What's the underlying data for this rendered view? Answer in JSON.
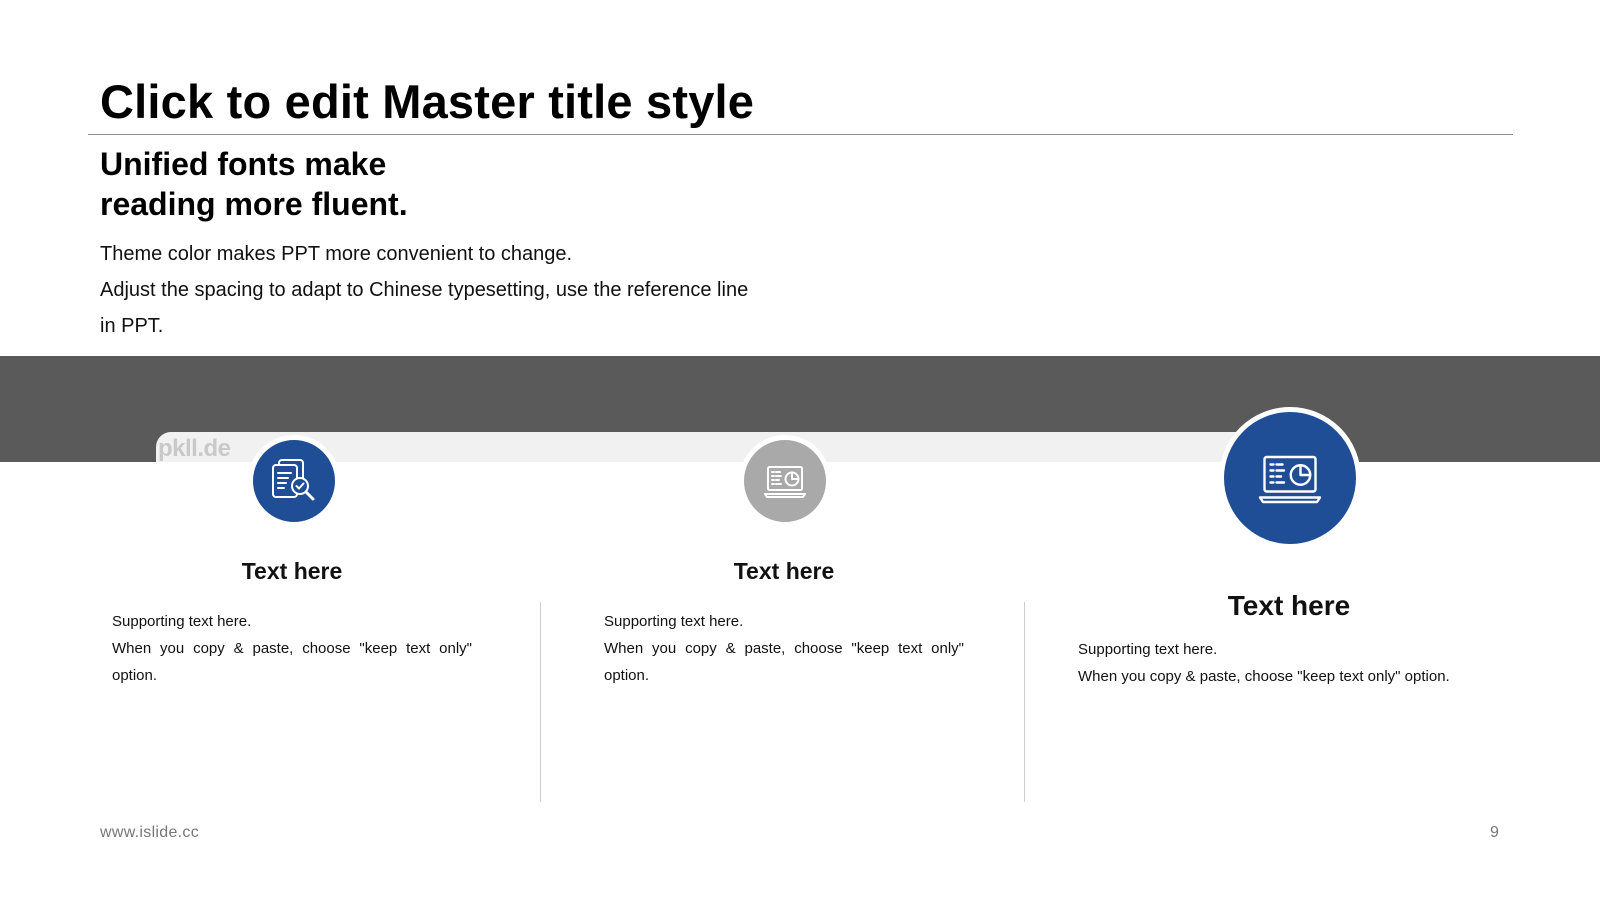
{
  "slide": {
    "title": "Click to edit Master title style",
    "subtitle_lines": [
      "Unified fonts make",
      "reading more fluent."
    ],
    "body_lines": [
      "Theme color makes PPT more convenient to change.",
      "Adjust the spacing to adapt to Chinese typesetting, use the reference line",
      "in PPT."
    ],
    "watermark": "pkll.de"
  },
  "cards": [
    {
      "icon": "document-search-icon",
      "title": "Text here",
      "lines": [
        "Supporting text here.",
        "When you copy & paste, choose \"keep text only\" option."
      ]
    },
    {
      "icon": "laptop-chart-icon",
      "title": "Text here",
      "lines": [
        "Supporting text here.",
        "When you copy & paste, choose \"keep text only\" option."
      ]
    },
    {
      "icon": "laptop-chart-icon",
      "title": "Text here",
      "lines": [
        "Supporting text here.",
        "When you copy & paste, choose \"keep text only\" option."
      ]
    }
  ],
  "footer": {
    "url": "www.islide.cc",
    "page_number": "9"
  },
  "colors": {
    "accent": "#1f4e96",
    "inactive": "#a9a9a9",
    "band": "#5a5a5a"
  }
}
